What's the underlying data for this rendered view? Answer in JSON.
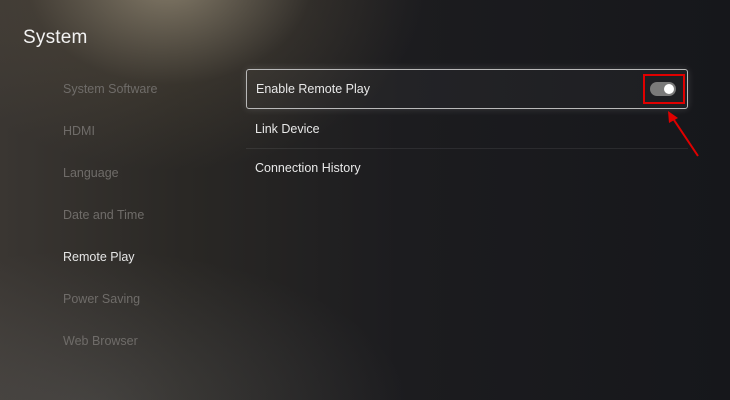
{
  "page": {
    "title": "System"
  },
  "sidebar": {
    "items": [
      {
        "label": "System Software"
      },
      {
        "label": "HDMI"
      },
      {
        "label": "Language"
      },
      {
        "label": "Date and Time"
      },
      {
        "label": "Remote Play",
        "active": true
      },
      {
        "label": "Power Saving"
      },
      {
        "label": "Web Browser"
      }
    ]
  },
  "settings": {
    "items": [
      {
        "label": "Enable Remote Play",
        "toggle_state": "on"
      },
      {
        "label": "Link Device"
      },
      {
        "label": "Connection History"
      }
    ]
  },
  "annotation": {
    "color": "#e00000",
    "icon": "arrow-up-left-icon"
  }
}
